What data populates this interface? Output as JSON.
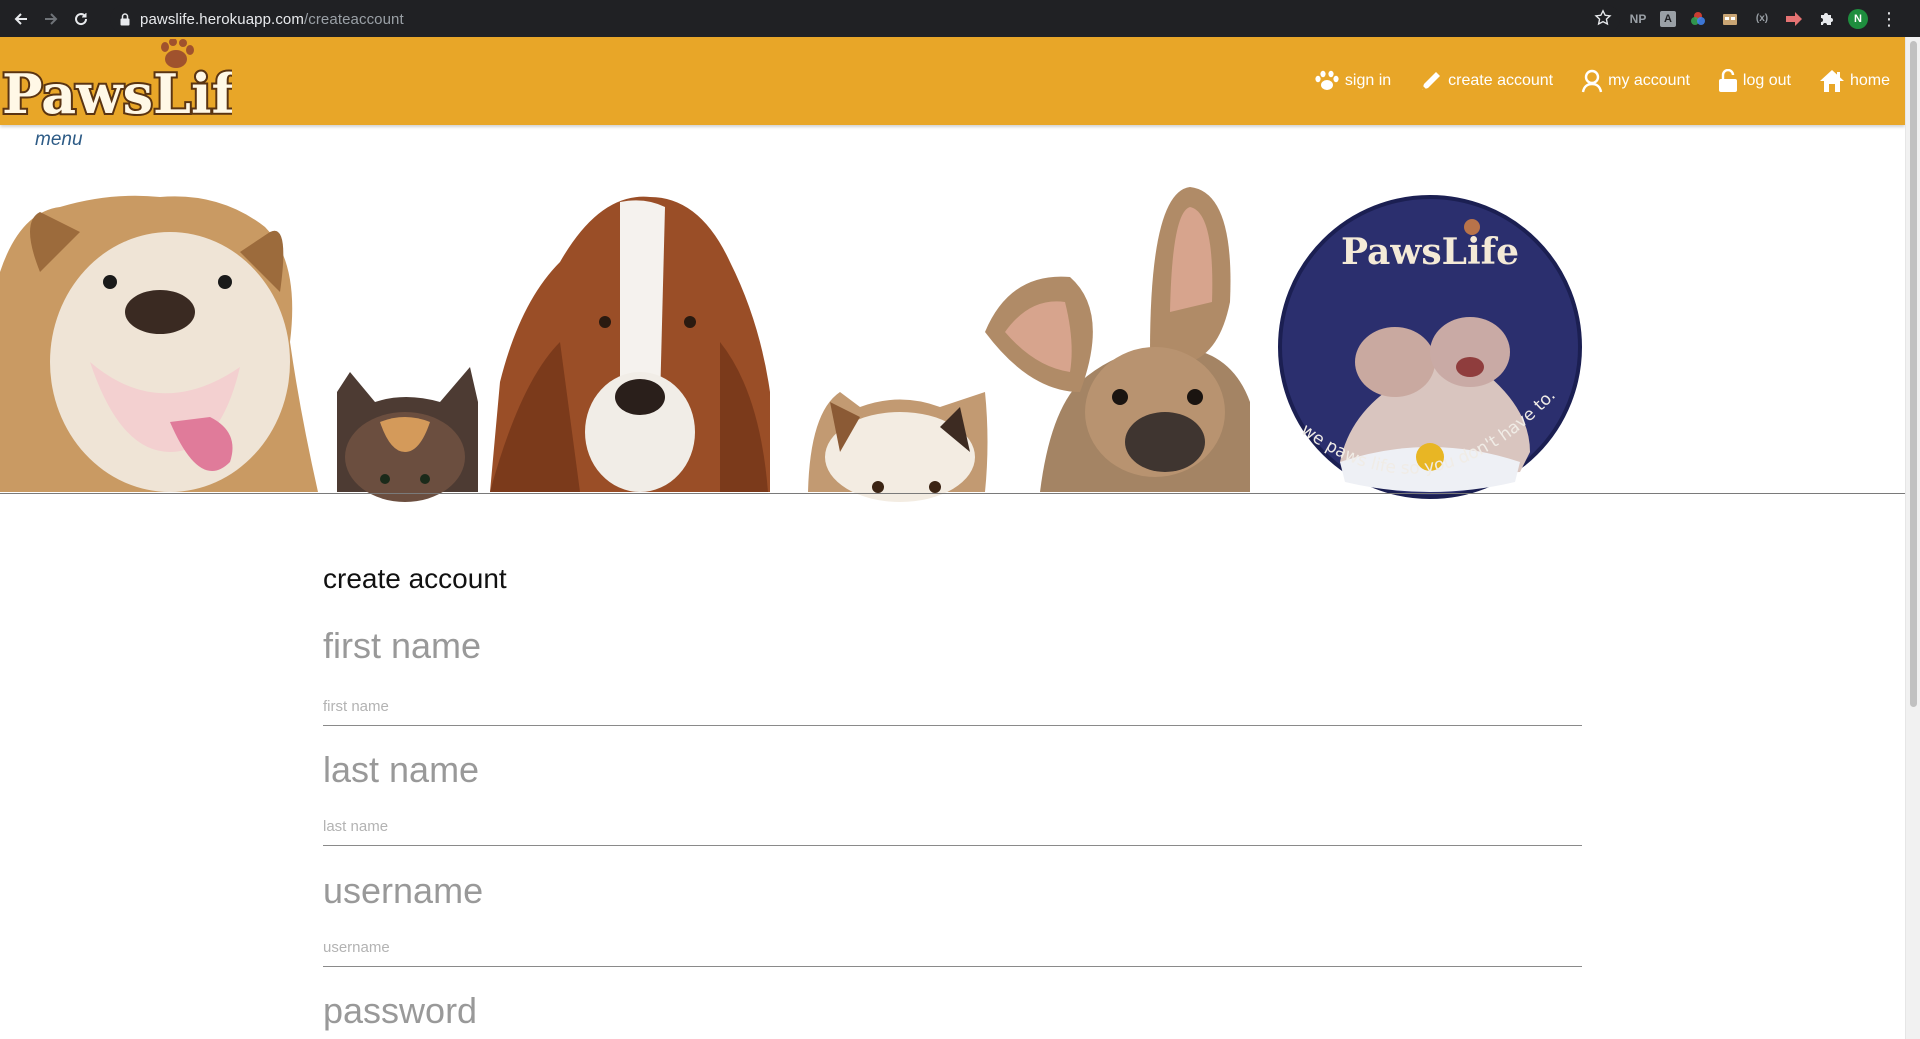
{
  "browser": {
    "url_host": "pawslife.herokuapp.com",
    "url_path": "/createaccount",
    "extensions": [
      "NP",
      "A",
      "color-wheel",
      "box",
      "(x)",
      "arrow"
    ],
    "profile_initial": "N"
  },
  "header": {
    "logo_text": "PawsLife",
    "nav": [
      {
        "label": "sign in",
        "icon": "paw-icon"
      },
      {
        "label": "create account",
        "icon": "pencil-icon"
      },
      {
        "label": "my account",
        "icon": "user-icon"
      },
      {
        "label": "log out",
        "icon": "lock-icon"
      },
      {
        "label": "home",
        "icon": "house-icon"
      }
    ],
    "background": "#e8a628"
  },
  "menu": {
    "label": "menu"
  },
  "banner": {
    "badge_title": "PawsLife",
    "badge_tagline": "we paws life so you don't have to."
  },
  "form": {
    "title": "create account",
    "fields": [
      {
        "label": "first name",
        "placeholder": "first name"
      },
      {
        "label": "last name",
        "placeholder": "last name"
      },
      {
        "label": "username",
        "placeholder": "username"
      },
      {
        "label": "password"
      }
    ]
  }
}
